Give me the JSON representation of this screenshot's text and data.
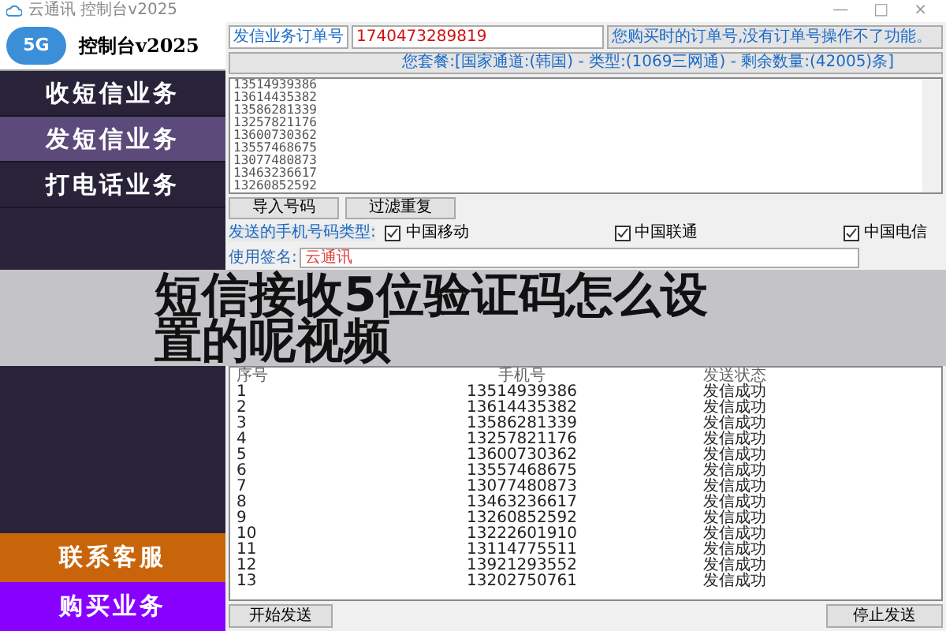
{
  "window": {
    "title": "云通讯 控制台v2025",
    "controls": [
      "—",
      "□",
      "×"
    ]
  },
  "sidebar": {
    "logo_badge": "5G",
    "logo_text": "控制台v2025",
    "items": [
      {
        "label": "收短信业务",
        "selected": false
      },
      {
        "label": "发短信业务",
        "selected": true
      },
      {
        "label": "打电话业务",
        "selected": false
      }
    ],
    "bottom_buttons": [
      {
        "label": "联系客服",
        "color": "#c8650a"
      },
      {
        "label": "购买业务",
        "color": "#8800ff"
      }
    ]
  },
  "order": {
    "label": "发信业务订单号",
    "value": "1740473289819",
    "hint": "您购买时的订单号,没有订单号操作不了功能。"
  },
  "plan": "您套餐:[国家通道:(韩国) - 类型:(1069三网通) - 剩余数量:(42005)条]",
  "numbers": [
    "13514939386",
    "13614435382",
    "13586281339",
    "13257821176",
    "13600730362",
    "13557468675",
    "13077480873",
    "13463236617",
    "13260852592"
  ],
  "buttons": [
    "导入号码",
    "过滤重复"
  ],
  "carrier_label": "发送的手机号码类型:",
  "carriers": [
    {
      "label": "中国移动",
      "checked": true
    },
    {
      "label": "中国联通",
      "checked": true
    },
    {
      "label": "中国电信",
      "checked": true
    }
  ],
  "signature": {
    "label": "使用签名:",
    "value": "云通讯"
  },
  "table": {
    "columns": [
      "序号",
      "手机号",
      "发送状态"
    ],
    "rows": [
      [
        "1",
        "13514939386",
        "发信成功"
      ],
      [
        "2",
        "13614435382",
        "发信成功"
      ],
      [
        "3",
        "13586281339",
        "发信成功"
      ],
      [
        "4",
        "13257821176",
        "发信成功"
      ],
      [
        "5",
        "13600730362",
        "发信成功"
      ],
      [
        "6",
        "13557468675",
        "发信成功"
      ],
      [
        "7",
        "13077480873",
        "发信成功"
      ],
      [
        "8",
        "13463236617",
        "发信成功"
      ],
      [
        "9",
        "13260852592",
        "发信成功"
      ],
      [
        "10",
        "13222601910",
        "发信成功"
      ],
      [
        "11",
        "13114775511",
        "发信成功"
      ],
      [
        "12",
        "13921293552",
        "发信成功"
      ],
      [
        "13",
        "13202750761",
        "发信成功"
      ]
    ]
  },
  "start_button": "开始发送",
  "stop_button": "停止发送",
  "overlay_title": [
    "短信接收5位验证码怎么设",
    "置的呢视频"
  ]
}
